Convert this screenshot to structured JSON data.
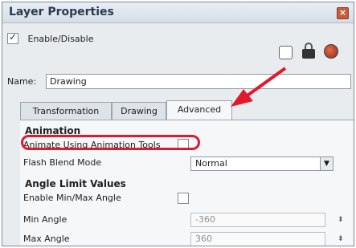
{
  "window": {
    "title": "Layer Properties"
  },
  "enable": {
    "label": "Enable/Disable",
    "checked": true
  },
  "name": {
    "label": "Name:",
    "value": "Drawing"
  },
  "tabs": [
    {
      "label": "Transformation",
      "active": false
    },
    {
      "label": "Drawing",
      "active": false
    },
    {
      "label": "Advanced",
      "active": true
    }
  ],
  "animation": {
    "section_title": "Animation",
    "animate_label": "Animate Using Animation Tools",
    "flash_label": "Flash Blend Mode",
    "flash_value": "Normal"
  },
  "angle": {
    "section_title": "Angle Limit Values",
    "enable_label": "Enable Min/Max Angle",
    "min_label": "Min Angle",
    "min_value": "-360",
    "max_label": "Max Angle",
    "max_value": "360"
  },
  "icons": {
    "close": "close-icon",
    "lock": "lock-icon",
    "onion": "onion-skin-icon",
    "spin": "spinner-icon"
  },
  "colors": {
    "highlight": "#e3182d",
    "arrow": "#e3182d"
  }
}
